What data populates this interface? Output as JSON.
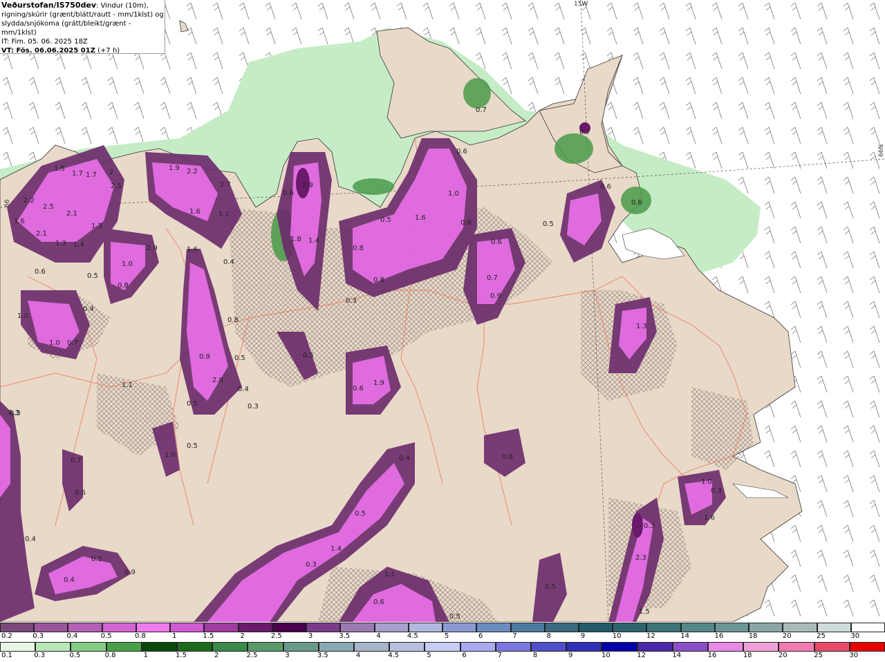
{
  "info": {
    "source": "Veðurstofan/IS750dev",
    "desc1": ": Vindur (10m),",
    "desc2": "rigning/skúrir (grænt/blátt/rautt - mm/1klst) og",
    "desc3": "slydda/snjókoma (grátt/bleikt/grænt - mm/1klst)",
    "it": "IT: Fim. 05. 06. 2025 18Z",
    "vt": "VT: Fös. 06.06.2025 01Z",
    "vt_offset": "(+7 h)"
  },
  "graticule": {
    "lon_label": "15W",
    "lat_label": "66N",
    "left_label": "66"
  },
  "colors": {
    "land": "#e9d9c8",
    "sea": "#ffffff",
    "rain_light": "#c5ecc5",
    "rain_mid": "#8ed48e",
    "rain_dark": "#2e7d32",
    "snow_light": "#c06ec0",
    "snow_bright": "#e56ee5",
    "snow_dark": "#6b2a6b",
    "roads": "#e8826a"
  },
  "precip_labels": [
    {
      "t": "1.5"
    },
    {
      "t": "1.7"
    },
    {
      "t": "1.7"
    },
    {
      "t": "2"
    },
    {
      "t": "2.5"
    },
    {
      "t": "2.2"
    },
    {
      "t": "2.5"
    },
    {
      "t": "1.6"
    },
    {
      "t": "2.1"
    },
    {
      "t": "2.1"
    },
    {
      "t": "1.3"
    },
    {
      "t": "1.3"
    },
    {
      "t": "1.4"
    },
    {
      "t": "0.6"
    },
    {
      "t": "1.9"
    },
    {
      "t": "2.2"
    },
    {
      "t": "2.7"
    },
    {
      "t": "1.6"
    },
    {
      "t": "1.1"
    },
    {
      "t": "1.0"
    },
    {
      "t": "0.8"
    },
    {
      "t": "0.5"
    },
    {
      "t": "2.9"
    },
    {
      "t": "1.6"
    },
    {
      "t": "0.4"
    },
    {
      "t": "2.9"
    },
    {
      "t": "1.8"
    },
    {
      "t": "1.4"
    },
    {
      "t": "0.6"
    },
    {
      "t": "1.6"
    },
    {
      "t": "1.0"
    },
    {
      "t": "0.8"
    },
    {
      "t": "0.8"
    },
    {
      "t": "0.6"
    },
    {
      "t": "0.3"
    },
    {
      "t": "0.5"
    },
    {
      "t": "0.7"
    },
    {
      "t": "0.6"
    },
    {
      "t": "0.9"
    },
    {
      "t": "0.5"
    },
    {
      "t": "0.6"
    },
    {
      "t": "0.7"
    },
    {
      "t": "0.8"
    },
    {
      "t": "1.3"
    },
    {
      "t": "1.0"
    },
    {
      "t": "0.4"
    },
    {
      "t": "1.0"
    },
    {
      "t": "0.7"
    },
    {
      "t": "0.9"
    },
    {
      "t": "2.0"
    },
    {
      "t": "0.8"
    },
    {
      "t": "0.5"
    },
    {
      "t": "0.4"
    },
    {
      "t": "0.5"
    },
    {
      "t": "0.3"
    },
    {
      "t": "0.5"
    },
    {
      "t": "0.6"
    },
    {
      "t": "1.9"
    },
    {
      "t": "1.0"
    },
    {
      "t": "0.5"
    },
    {
      "t": "0.3"
    },
    {
      "t": "0.7"
    },
    {
      "t": "0.6"
    },
    {
      "t": "0.4"
    },
    {
      "t": "0.6"
    },
    {
      "t": "0.5"
    },
    {
      "t": "1.4"
    },
    {
      "t": "0.4"
    },
    {
      "t": "0.3"
    },
    {
      "t": "0.5"
    },
    {
      "t": "0.9"
    },
    {
      "t": "0.4"
    },
    {
      "t": "1.1"
    },
    {
      "t": "0.6"
    },
    {
      "t": "0.5"
    },
    {
      "t": "0.3"
    },
    {
      "t": "2.3"
    },
    {
      "t": "1.5"
    },
    {
      "t": "1.0"
    },
    {
      "t": "1.6"
    },
    {
      "t": "0.3"
    },
    {
      "t": "0.5"
    },
    {
      "t": "1.1"
    },
    {
      "t": "0.3"
    },
    {
      "t": "0.7"
    },
    {
      "t": "0.6"
    },
    {
      "t": "0.6"
    }
  ],
  "scale_snow": {
    "ticks": [
      "0.2",
      "0.3",
      "0.4",
      "0.5",
      "0.8",
      "1",
      "1.5",
      "2",
      "2.5",
      "3",
      "3.5",
      "4",
      "4.5",
      "5",
      "6",
      "7",
      "8",
      "9",
      "10",
      "12",
      "14",
      "16",
      "18",
      "20",
      "25",
      "30"
    ],
    "colors": [
      "#7a4a7a",
      "#9a569a",
      "#b65fb6",
      "#d466d4",
      "#ee7aee",
      "#d05ad0",
      "#a03ca0",
      "#6a1a6a",
      "#4a004a",
      "#7a3c8a",
      "#9a7ab0",
      "#a6a0cc",
      "#b0b8de",
      "#8a9ad0",
      "#6c8cbf",
      "#4f7aa0",
      "#3a6a80",
      "#245a6a",
      "#2c6470",
      "#3c7478",
      "#558688",
      "#6c9696",
      "#88a6a6",
      "#a8bcbc",
      "#d0dcdc",
      "#ffffff"
    ]
  },
  "scale_rain": {
    "ticks": [
      "0.1",
      "0.3",
      "0.5",
      "0.8",
      "1",
      "1.5",
      "2",
      "2.5",
      "3",
      "3.5",
      "4",
      "4.5",
      "5",
      "6",
      "7",
      "8",
      "9",
      "10",
      "12",
      "14",
      "16",
      "18",
      "20",
      "25",
      "30"
    ],
    "colors": [
      "#e6f8e6",
      "#b8e6b8",
      "#84cc84",
      "#4aa04a",
      "#0a4a0a",
      "#1c6a1c",
      "#3a8a4a",
      "#5a9a6a",
      "#6a9a8a",
      "#8aa8b4",
      "#a6b4cc",
      "#b6c0e0",
      "#c6ccf4",
      "#a8aaf0",
      "#7878e0",
      "#5050cc",
      "#3030b8",
      "#0000a8",
      "#4a2aa8",
      "#8a50c8",
      "#e68ae6",
      "#f0a0d8",
      "#f07cb4",
      "#e84a6a",
      "#e80000"
    ]
  }
}
